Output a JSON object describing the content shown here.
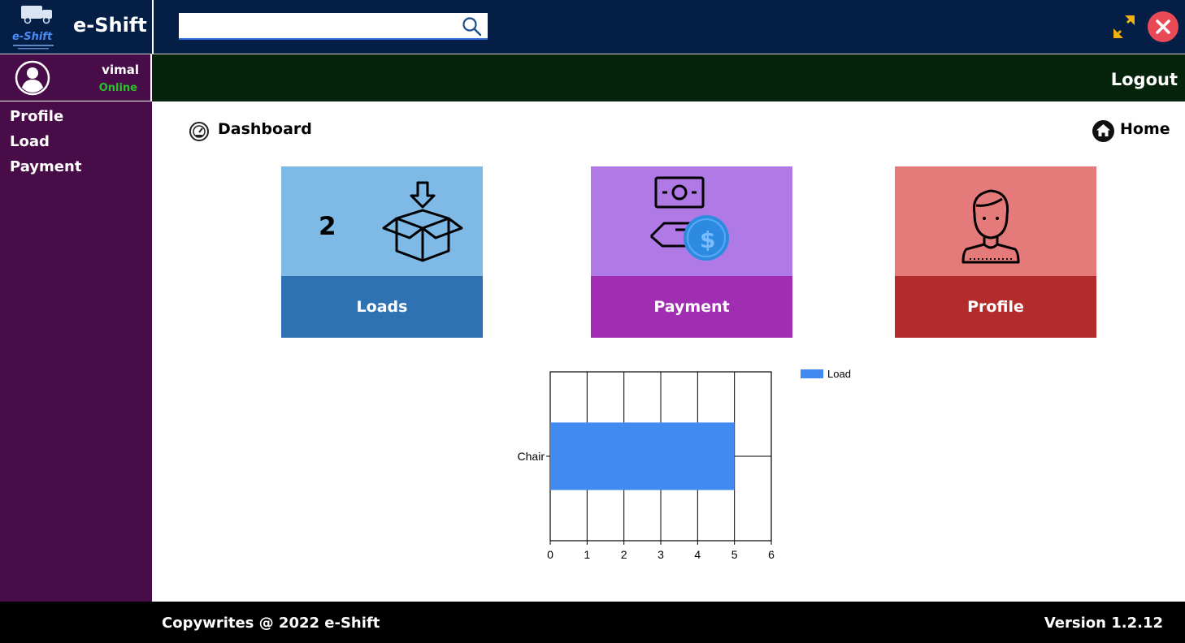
{
  "app": {
    "name": "e-Shift",
    "logo_text": "e-Shift"
  },
  "search": {
    "placeholder": "",
    "value": "",
    "icon": "search-icon"
  },
  "window_controls": {
    "minimize_icon": "minimize-icon",
    "close_icon": "close-icon"
  },
  "user": {
    "name": "vimal",
    "status": "Online",
    "status_color": "#26c426"
  },
  "header": {
    "logout_label": "Logout"
  },
  "sidebar": {
    "items": [
      {
        "label": "Profile"
      },
      {
        "label": "Load"
      },
      {
        "label": "Payment"
      }
    ]
  },
  "main": {
    "title": "Dashboard",
    "home_label": "Home",
    "cards": [
      {
        "label": "Loads",
        "count": "2",
        "icon": "box-download-icon",
        "color_top": "#7fb9e5",
        "color_bottom": "#2e72b4"
      },
      {
        "label": "Payment",
        "icon": "payment-hand-icon",
        "color_top": "#b07ae6",
        "color_bottom": "#a12db3"
      },
      {
        "label": "Profile",
        "icon": "person-icon",
        "color_top": "#e57a7a",
        "color_bottom": "#b42b2b"
      }
    ]
  },
  "chart_data": {
    "type": "bar",
    "orientation": "horizontal",
    "categories": [
      "Chair"
    ],
    "series": [
      {
        "name": "Load",
        "values": [
          5
        ],
        "color": "#418af0"
      }
    ],
    "xlim": [
      0,
      6
    ],
    "xticks": [
      "0",
      "1",
      "2",
      "3",
      "4",
      "5",
      "6"
    ],
    "grid": true,
    "legend": "top-right"
  },
  "footer": {
    "copyright": "Copywrites @ 2022 e-Shift",
    "version": "Version 1.2.12"
  },
  "colors": {
    "topbar": "#041e46",
    "sidebar": "#480c48",
    "userbar": "#06230b",
    "footer": "#000000"
  }
}
